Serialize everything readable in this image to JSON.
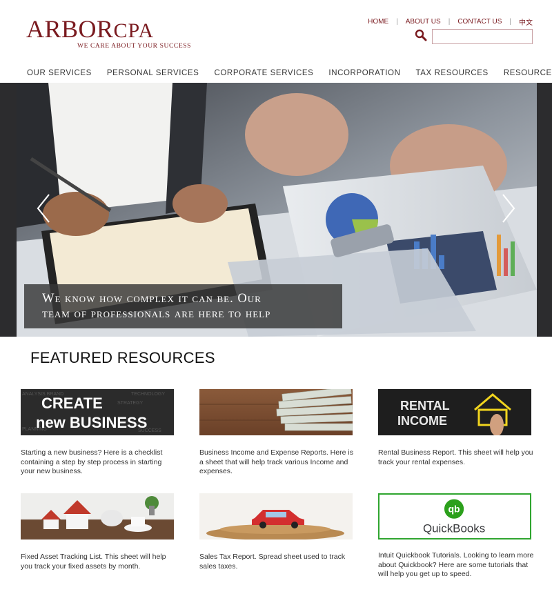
{
  "brand": {
    "logo_big": "ARBOR",
    "logo_cpa": "CPA",
    "tagline": "WE CARE ABOUT YOUR SUCCESS",
    "color": "#7a1a1f"
  },
  "toplinks": {
    "home": "HOME",
    "about": "ABOUT US",
    "contact": "CONTACT US",
    "lang": "中文",
    "sep": "|"
  },
  "search": {
    "placeholder": "",
    "icon": "search-icon"
  },
  "nav": {
    "items": [
      "OUR SERVICES",
      "PERSONAL SERVICES",
      "CORPORATE SERVICES",
      "INCORPORATION",
      "TAX RESOURCES",
      "RESOURCES"
    ]
  },
  "hero": {
    "caption_line1": "We know how complex it can be. Our",
    "caption_line2": "team of professionals are here to help"
  },
  "featured": {
    "title": "FEATURED RESOURCES",
    "cards": [
      {
        "image_text_1": "CREATE",
        "image_text_2": "new BUSINESS",
        "desc": "Starting a new business? Here is a checklist containing a step by step process in starting your new business."
      },
      {
        "desc": "Business Income and Expense Reports. Here is a sheet that will help track various Income and expenses."
      },
      {
        "image_text_1": "RENTAL",
        "image_text_2": "INCOME",
        "desc": "Rental Business Report. This sheet will help you track your rental expenses."
      },
      {
        "desc": "Fixed Asset Tracking List. This sheet will help you track your fixed assets by month."
      },
      {
        "desc": "Sales Tax Report. Spread sheet used to track sales taxes."
      },
      {
        "image_text_1": "qb",
        "image_text_2": "QuickBooks",
        "desc": "Intuit Quickbook Tutorials. Looking to learn more about Quickbook? Here are some tutorials that will help you get up to speed."
      }
    ]
  }
}
